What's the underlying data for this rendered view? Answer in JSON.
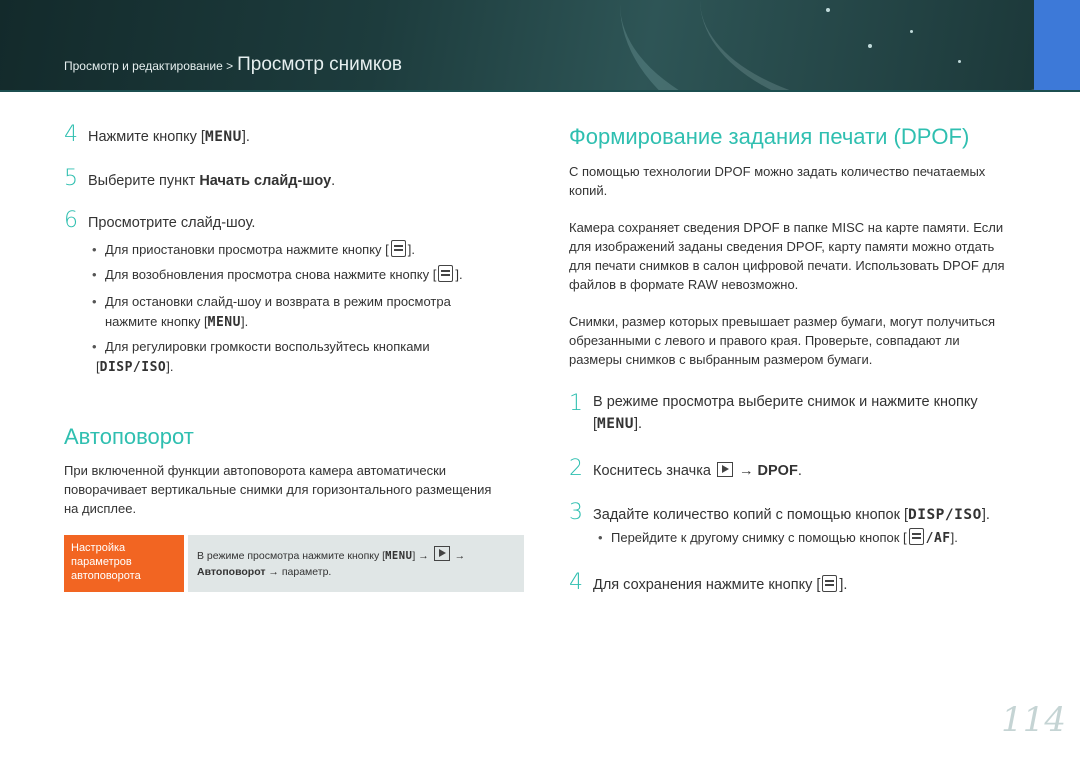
{
  "header": {
    "breadcrumb_section": "Просмотр и редактирование >",
    "breadcrumb_title": "Просмотр снимков"
  },
  "left": {
    "step4": {
      "num": "4",
      "text": "Нажмите кнопку [",
      "key": "MENU",
      "after": "]."
    },
    "step5": {
      "num": "5",
      "text": "Выберите пункт ",
      "bold": "Начать слайд-шоу",
      "after": "."
    },
    "step6": {
      "num": "6",
      "text": "Просмотрите слайд-шоу."
    },
    "bullets": [
      {
        "text": "Для приостановки просмотра нажмите кнопку [",
        "icon": "ok-icon",
        "after": "]."
      },
      {
        "text": "Для возобновления просмотра снова нажмите кнопку [",
        "icon": "ok-icon",
        "after": "]."
      },
      {
        "line1": "Для остановки слайд-шоу и возврата в режим просмотра",
        "line2": "нажмите кнопку [",
        "key": "MENU",
        "after": "]."
      },
      {
        "line1": "Для регулировки громкости воспользуйтесь кнопками",
        "line2": "[",
        "key": "DISP/ISO",
        "after": "]."
      }
    ],
    "autorotate_title": "Автоповорот",
    "autorotate_para": [
      "При включенной функции автоповорота камера автоматически",
      "поворачивает вертикальные снимки для горизонтального размещения",
      "на дисплее."
    ],
    "note": {
      "tag_lines": [
        "Настройка",
        "параметров",
        "автоповорота"
      ],
      "line1_text": "В режиме просмотра нажмите кнопку [",
      "line1_key": "MENU",
      "line1_after": "] →",
      "line1_end": "→",
      "line2_bold": "Автоповорот",
      "line2_after": " → параметр."
    }
  },
  "right": {
    "dpof_title": "Формирование задания печати (DPOF)",
    "para1": [
      "С помощью технологии DPOF можно задать количество печатаемых",
      "копий."
    ],
    "para2": [
      "Камера сохраняет сведения DPOF в папке MISC на карте памяти. Если",
      "для изображений заданы сведения DPOF, карту памяти можно отдать",
      "для печати снимков в салон цифровой печати. Использовать DPOF для",
      "файлов в формате RAW невозможно."
    ],
    "para3": [
      "Снимки, размер которых превышает размер бумаги, могут получиться",
      "обрезанными с левого и правого края. Проверьте, совпадают ли",
      "размеры снимков с выбранным размером бумаги."
    ],
    "step1": {
      "num": "1",
      "line1": "В режиме просмотра выберите снимок и нажмите кнопку",
      "line2_pre": "[",
      "key": "MENU",
      "after": "]."
    },
    "step2": {
      "num": "2",
      "text": "Коснитесь значка ",
      "arrow": "→",
      "bold": "DPOF",
      "after": "."
    },
    "step3": {
      "num": "3",
      "text": "Задайте количество копий с помощью кнопок [",
      "key": "DISP/ISO",
      "after": "]."
    },
    "bullet": {
      "text": "Перейдите к другому снимку с помощью кнопок [",
      "key": "/AF",
      "after": "]."
    },
    "step4": {
      "num": "4",
      "text": "Для сохранения нажмите кнопку [",
      "after": "]."
    }
  },
  "page_number": "114",
  "colors": {
    "accent_teal": "#2fbfb0",
    "note_orange": "#f26522",
    "note_bg": "#e0e6e6",
    "banner_blue": "#3d79d8"
  }
}
